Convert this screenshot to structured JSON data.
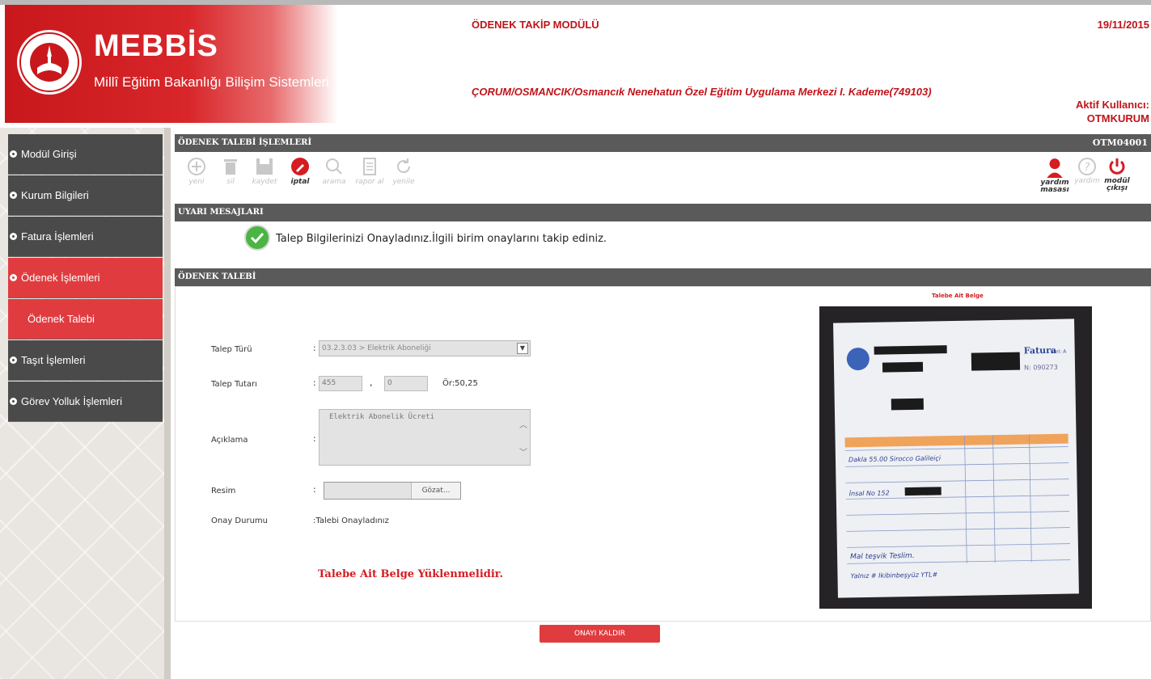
{
  "header": {
    "brand": "MEBBİS",
    "brand_subtitle": "Millî Eğitim Bakanlığı Bilişim Sistemleri",
    "module_title": "ÖDENEK TAKİP MODÜLÜ",
    "date": "19/11/2015",
    "institution": "ÇORUM/OSMANCIK/Osmancık Nenehatun Özel Eğitim Uygulama Merkezi I. Kademe(749103)",
    "active_user_label": "Aktif Kullanıcı:",
    "active_user": "OTMKURUM"
  },
  "sidebar": {
    "items": [
      {
        "label": "Modül Girişi"
      },
      {
        "label": "Kurum Bilgileri"
      },
      {
        "label": "Fatura İşlemleri"
      },
      {
        "label": "Ödenek İşlemleri"
      },
      {
        "label": "Ödenek Talebi"
      },
      {
        "label": "Taşıt İşlemleri"
      },
      {
        "label": "Görev Yolluk İşlemleri"
      }
    ]
  },
  "page": {
    "title": "ÖDENEK TALEBİ İŞLEMLERİ",
    "code": "OTM04001"
  },
  "toolbar": {
    "yeni": "yeni",
    "sil": "sil",
    "kaydet": "kaydet",
    "iptal": "iptal",
    "arama": "arama",
    "raporal": "rapor al",
    "yenile": "yenile",
    "yardim_masasi_1": "yardım",
    "yardim_masasi_2": "masası",
    "yardim": "yardım",
    "modul_cikisi_1": "modül",
    "modul_cikisi_2": "çıkışı"
  },
  "warnings": {
    "title": "UYARI MESAJLARI",
    "message": "Talep Bilgilerinizi Onayladınız.İlgili birim onaylarını takip ediniz."
  },
  "form": {
    "title": "ÖDENEK TALEBİ",
    "talep_turu_label": "Talep Türü",
    "talep_turu_value": "03.2.3.03 > Elektrik Aboneliği",
    "talep_tutari_label": "Talep Tutarı",
    "tutar_lira": "455",
    "tutar_kurus": "0",
    "tutar_sep": ",",
    "tutar_hint": "Ör:50,25",
    "aciklama_label": "Açıklama",
    "aciklama_value": "Elektrik Abonelik Ücreti",
    "resim_label": "Resim",
    "browse_button": "Gözat...",
    "onay_durumu_label": "Onay Durumu",
    "onay_durumu_value": ":Talebi Onayladınız",
    "colon": ":",
    "warning_red": "Talebe Ait Belge Yüklenmelidir.",
    "image_caption": "Talebe Ait Belge",
    "remove_approval_button": "ONAYI KALDIR"
  },
  "receipt_image": {
    "heading": "Fatura",
    "serial": "Seri: A",
    "number": "N: 090273",
    "row1": "Dakla 55.00 Sirocco Galileiçi",
    "row2": "İnsal No 152",
    "footer": "Mal teşvik Teslim.",
    "total_words": "Yalnız # Ikibinbeşyüz YTL#"
  },
  "colors": {
    "brand_red": "#d8262a",
    "menu_dark": "#4a4a4a",
    "bar_gray": "#5a5a5a",
    "accent_red": "#e03c3f"
  }
}
